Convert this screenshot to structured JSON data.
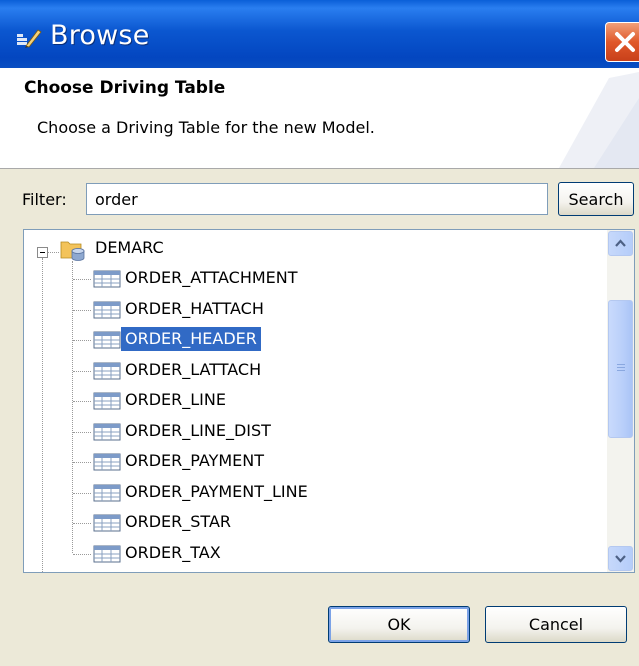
{
  "window": {
    "title": "Browse",
    "title_icon": "browse-icon",
    "close_icon": "close-icon"
  },
  "header": {
    "title": "Choose Driving Table",
    "subtitle": "Choose a Driving Table for the new Model."
  },
  "filter": {
    "label": "Filter:",
    "value": "order",
    "search_label": "Search"
  },
  "tree": {
    "root": {
      "label": "DEMARC",
      "icon": "database-folder-icon",
      "expanded": true
    },
    "items": [
      {
        "label": "ORDER_ATTACHMENT",
        "icon": "table-icon",
        "selected": false
      },
      {
        "label": "ORDER_HATTACH",
        "icon": "table-icon",
        "selected": false
      },
      {
        "label": "ORDER_HEADER",
        "icon": "table-icon",
        "selected": true
      },
      {
        "label": "ORDER_LATTACH",
        "icon": "table-icon",
        "selected": false
      },
      {
        "label": "ORDER_LINE",
        "icon": "table-icon",
        "selected": false
      },
      {
        "label": "ORDER_LINE_DIST",
        "icon": "table-icon",
        "selected": false
      },
      {
        "label": "ORDER_PAYMENT",
        "icon": "table-icon",
        "selected": false
      },
      {
        "label": "ORDER_PAYMENT_LINE",
        "icon": "table-icon",
        "selected": false
      },
      {
        "label": "ORDER_STAR",
        "icon": "table-icon",
        "selected": false
      },
      {
        "label": "ORDER_TAX",
        "icon": "table-icon",
        "selected": false
      }
    ]
  },
  "buttons": {
    "ok_label": "OK",
    "cancel_label": "Cancel"
  },
  "colors": {
    "titlebar": "#0b57d0",
    "selection": "#316ac5",
    "dialog_bg": "#ece9d8",
    "close": "#e0582a"
  }
}
